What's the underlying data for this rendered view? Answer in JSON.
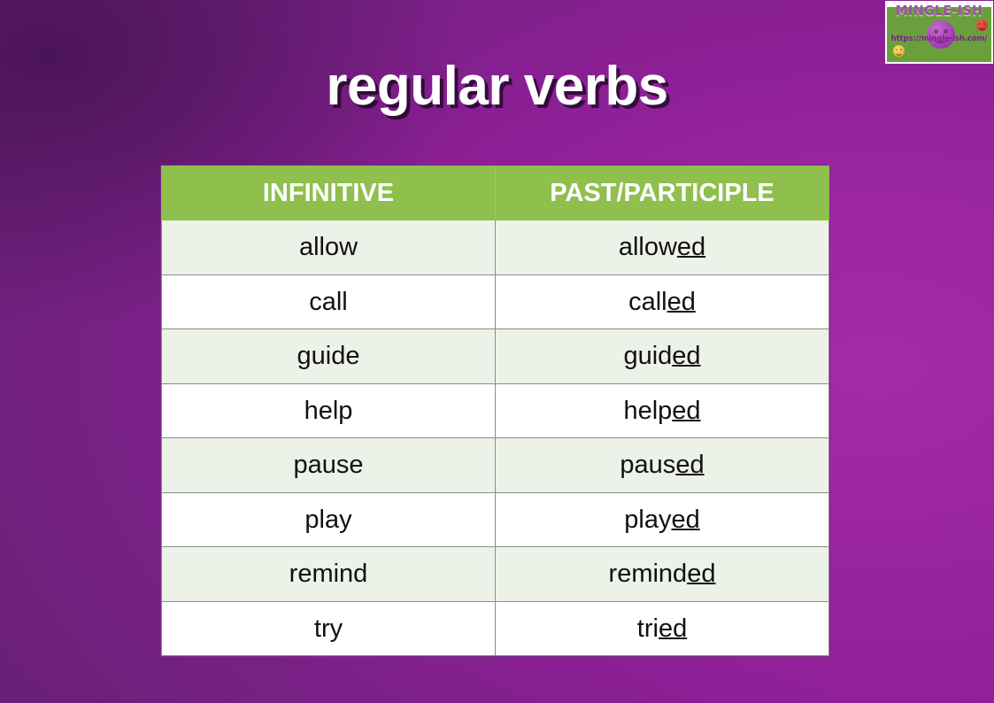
{
  "slide": {
    "title": "regular verbs",
    "background_color_dark": "#5f2069",
    "background_color_light": "#a32aa8",
    "title_color": "#ffffff"
  },
  "logo": {
    "wordmark": "MINGLE-ISH",
    "url": "https://mingle-ish.com/",
    "background_color": "#6aa03c",
    "wordmark_color": "#9d4fa8",
    "url_color": "#7d1f8c",
    "smileys": [
      {
        "name": "main-purple-smiley",
        "color": "#a93fb5"
      },
      {
        "name": "small-red-smiley",
        "color": "#d8352a"
      },
      {
        "name": "small-yellow-smiley",
        "color": "#e8b13a"
      }
    ]
  },
  "table": {
    "header_background": "#8fbf4d",
    "header_text_color": "#ffffff",
    "row_even_background": "#edf2e8",
    "row_odd_background": "#ffffff",
    "border_color": "#8c8c8c",
    "outer_border_color": "#7a2a86",
    "columns": [
      "INFINITIVE",
      "PAST/PARTICIPLE"
    ],
    "rows": [
      {
        "infinitive": "allow",
        "stem": "allow",
        "suffix": "ed",
        "past_participle": "allowed"
      },
      {
        "infinitive": "call",
        "stem": "call",
        "suffix": "ed",
        "past_participle": "called"
      },
      {
        "infinitive": "guide",
        "stem": "guid",
        "suffix": "ed",
        "past_participle": "guided"
      },
      {
        "infinitive": "help",
        "stem": "help",
        "suffix": "ed",
        "past_participle": "helped"
      },
      {
        "infinitive": "pause",
        "stem": "paus",
        "suffix": "ed",
        "past_participle": "paused"
      },
      {
        "infinitive": "play",
        "stem": "play",
        "suffix": "ed",
        "past_participle": "played"
      },
      {
        "infinitive": "remind",
        "stem": "remind",
        "suffix": "ed",
        "past_participle": "reminded"
      },
      {
        "infinitive": "try",
        "stem": "tri",
        "suffix": "ed",
        "past_participle": "tried"
      }
    ]
  }
}
